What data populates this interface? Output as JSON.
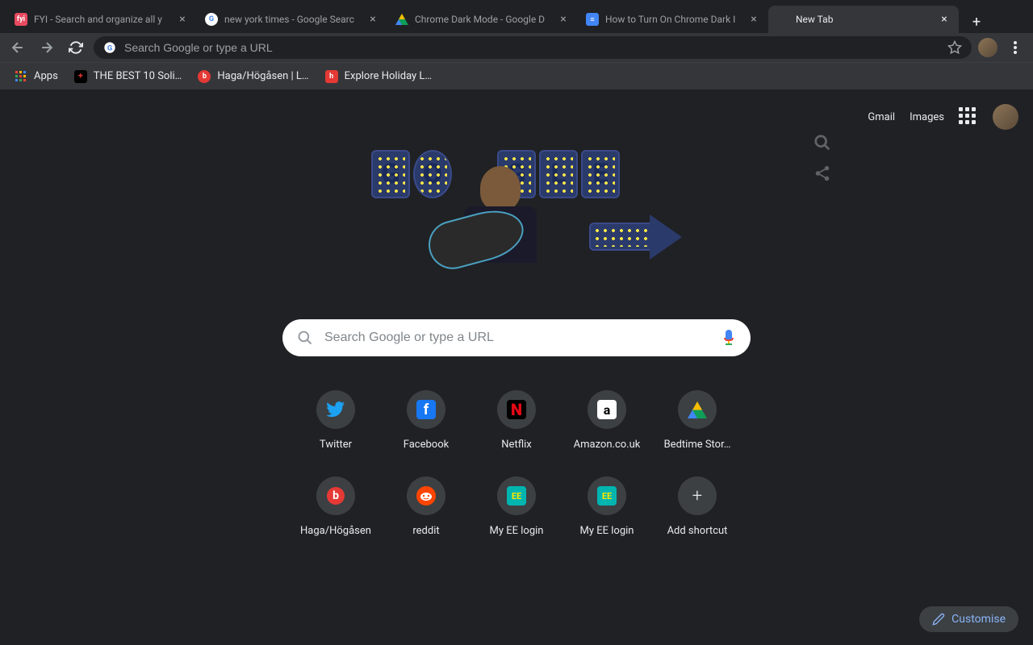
{
  "tabs": [
    {
      "title": "FYI - Search and organize all y",
      "favicon_bg": "#e84a5f",
      "favicon_text": "fyi",
      "favicon_color": "#fff"
    },
    {
      "title": "new york times - Google Searc",
      "favicon_bg": "#fff",
      "favicon_text": "G",
      "favicon_color": "#4285f4"
    },
    {
      "title": "Chrome Dark Mode - Google D",
      "favicon_bg": "transparent",
      "favicon_text": "▲",
      "favicon_color": "#0f9d58"
    },
    {
      "title": "How to Turn On Chrome Dark I",
      "favicon_bg": "#4285f4",
      "favicon_text": "≡",
      "favicon_color": "#fff"
    },
    {
      "title": "New Tab",
      "favicon_bg": "transparent",
      "favicon_text": "",
      "favicon_color": ""
    }
  ],
  "active_tab_index": 4,
  "omnibox": {
    "placeholder": "Search Google or type a URL"
  },
  "bookmarks": [
    {
      "label": "Apps",
      "icon_bg": "transparent",
      "icon_text": "⋮⋮⋮"
    },
    {
      "label": "THE BEST 10 Soli…",
      "icon_bg": "#000",
      "icon_text": "✦",
      "icon_color": "#d32f2f"
    },
    {
      "label": "Haga/Högåsen | L…",
      "icon_bg": "#e53935",
      "icon_text": "b",
      "icon_color": "#fff"
    },
    {
      "label": "Explore Holiday L…",
      "icon_bg": "#e53935",
      "icon_text": "h",
      "icon_color": "#fff"
    }
  ],
  "header": {
    "gmail": "Gmail",
    "images": "Images"
  },
  "search": {
    "placeholder": "Search Google or type a URL"
  },
  "shortcuts": [
    {
      "label": "Twitter",
      "bg": "#1da1f2",
      "text": "",
      "svg": "twitter"
    },
    {
      "label": "Facebook",
      "bg": "#1877f2",
      "text": "f"
    },
    {
      "label": "Netflix",
      "bg": "#000",
      "text": "N",
      "text_color": "#e50914"
    },
    {
      "label": "Amazon.co.uk",
      "bg": "#fff",
      "text": "a",
      "text_color": "#000"
    },
    {
      "label": "Bedtime Stor…",
      "bg": "transparent",
      "svg": "drive"
    },
    {
      "label": "Haga/Högåsen",
      "bg": "#e53935",
      "text": "b"
    },
    {
      "label": "reddit",
      "bg": "#ff4500",
      "text": "",
      "svg": "reddit"
    },
    {
      "label": "My EE login",
      "bg": "#00b5b0",
      "text": "EE",
      "text_color": "#ffe600"
    },
    {
      "label": "My EE login",
      "bg": "#00b5b0",
      "text": "EE",
      "text_color": "#ffe600"
    },
    {
      "label": "Add shortcut",
      "bg": "transparent",
      "text": "+",
      "add": true
    }
  ],
  "customise": {
    "label": "Customise"
  }
}
